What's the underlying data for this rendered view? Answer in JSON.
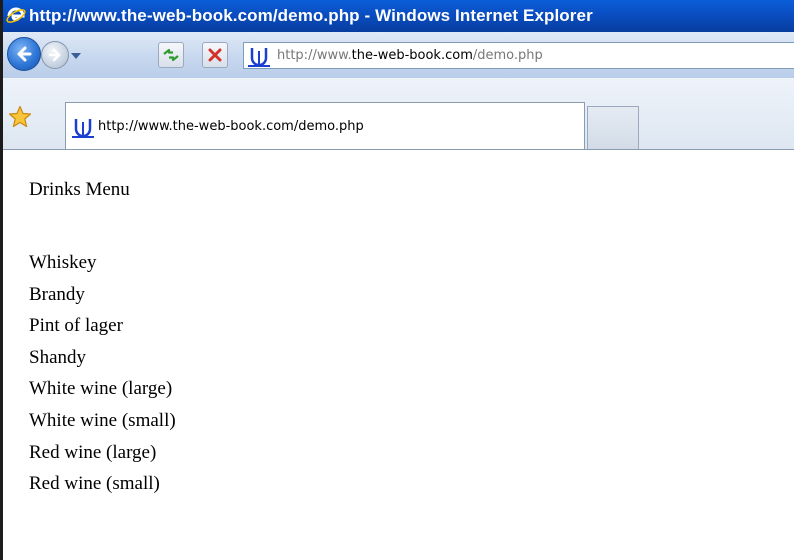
{
  "window": {
    "title": "http://www.the-web-book.com/demo.php - Windows Internet Explorer"
  },
  "address_bar": {
    "url_prefix": "http://www.",
    "url_domain": "the-web-book.com",
    "url_path": "/demo.php"
  },
  "tabs": [
    {
      "label": "http://www.the-web-book.com/demo.php",
      "active": true
    }
  ],
  "page": {
    "heading": "Drinks Menu",
    "drinks": [
      "Whiskey",
      "Brandy",
      "Pint of lager",
      "Shandy",
      "White wine (large)",
      "White wine (small)",
      "Red wine (large)",
      "Red wine (small)"
    ]
  },
  "icons": {
    "browser": "ie-logo-icon",
    "back": "back-arrow-icon",
    "forward": "forward-arrow-icon",
    "history": "chevron-down-icon",
    "refresh": "refresh-icon",
    "stop": "stop-icon",
    "site": "site-favicon-icon",
    "favorites": "favorites-star-icon"
  },
  "colors": {
    "titlebar": "#0a4fc4",
    "title_text": "#ffffff",
    "toolbar": "#c9d9ef",
    "favicon": "#1b3fd1"
  }
}
